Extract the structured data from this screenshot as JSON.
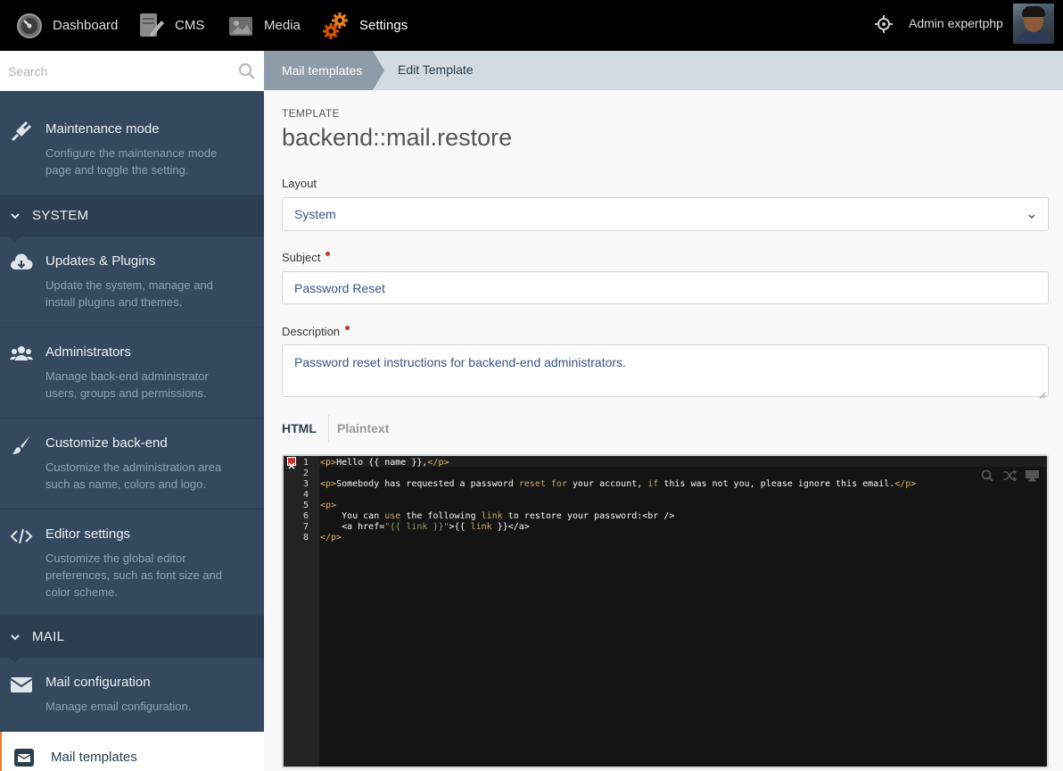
{
  "topnav": {
    "dashboard": "Dashboard",
    "cms": "CMS",
    "media": "Media",
    "settings": "Settings",
    "username": "Admin expertphp"
  },
  "sidebar": {
    "search_placeholder": "Search",
    "maintenance": {
      "title": "Maintenance mode",
      "desc": "Configure the maintenance mode page and toggle the setting."
    },
    "section_system": "SYSTEM",
    "updates": {
      "title": "Updates & Plugins",
      "desc": "Update the system, manage and install plugins and themes."
    },
    "admins": {
      "title": "Administrators",
      "desc": "Manage back-end administrator users, groups and permissions."
    },
    "customize": {
      "title": "Customize back-end",
      "desc": "Customize the administration area such as name, colors and logo."
    },
    "editor": {
      "title": "Editor settings",
      "desc": "Customize the global editor preferences, such as font size and color scheme."
    },
    "section_mail": "MAIL",
    "mailconfig": {
      "title": "Mail configuration",
      "desc": "Manage email configuration."
    },
    "mailtemplates": {
      "title": "Mail templates"
    }
  },
  "breadcrumb": {
    "parent": "Mail templates",
    "current": "Edit Template"
  },
  "form": {
    "template_label": "TEMPLATE",
    "template_code": "backend::mail.restore",
    "layout_label": "Layout",
    "layout_value": "System",
    "subject_label": "Subject",
    "subject_value": "Password Reset",
    "description_label": "Description",
    "description_value": "Password reset instructions for backend-end administrators.",
    "tab_html": "HTML",
    "tab_plaintext": "Plaintext"
  },
  "editor": {
    "line_numbers": [
      "1",
      "2",
      "3",
      "4",
      "5",
      "6",
      "7",
      "8"
    ]
  },
  "colors": {
    "topbar": "#000000",
    "sidebar": "#34495e",
    "accent": "#e67e22",
    "editor_bg": "#141414"
  }
}
